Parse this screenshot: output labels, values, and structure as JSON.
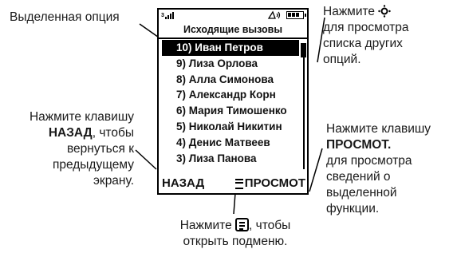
{
  "annotations": {
    "highlighted_option": "Выделенная опция",
    "nav_press": "Нажмите",
    "nav_rest": [
      "для просмотра",
      "списка других",
      "опций."
    ],
    "back_press": "Нажмите клавишу",
    "back_key": "НАЗАД",
    "back_rest_first": ", чтобы",
    "back_rest": [
      "вернуться к",
      "предыдущему",
      "экрану."
    ],
    "view_press": "Нажмите клавишу",
    "view_key": "ПРОСМОТ.",
    "view_rest": [
      "для просмотра",
      "сведений о",
      "выделенной",
      "функции."
    ],
    "menu_press": "Нажмите",
    "menu_rest": ", чтобы",
    "menu_line2": "открыть подменю."
  },
  "screen": {
    "title": "Исходящие вызовы",
    "items": [
      "10) Иван Петров",
      "9) Лиза Орлова",
      "8) Алла Симонова",
      "7) Александр Корн",
      "6) Мария Тимошенко",
      "5) Николай Никитин",
      "4) Денис Матвеев",
      "3) Лиза Панова"
    ],
    "selected_index": 0,
    "softkey_left": "НАЗАД",
    "softkey_right": "ПРОСМОТ",
    "status_icons": [
      "signal-icon",
      "ringer-icon",
      "battery-icon"
    ]
  }
}
